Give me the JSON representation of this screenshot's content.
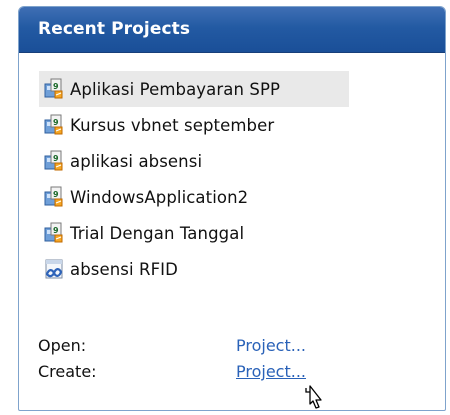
{
  "panel": {
    "title": "Recent Projects"
  },
  "projects": [
    {
      "label": "Aplikasi Pembayaran SPP",
      "icon": "vb-project-icon",
      "selected": true
    },
    {
      "label": "Kursus vbnet september",
      "icon": "vb-project-icon",
      "selected": false
    },
    {
      "label": "aplikasi absensi",
      "icon": "vb-project-icon",
      "selected": false
    },
    {
      "label": "WindowsApplication2",
      "icon": "vb-project-icon",
      "selected": false
    },
    {
      "label": "Trial Dengan Tanggal",
      "icon": "vb-project-icon",
      "selected": false
    },
    {
      "label": "absensi RFID",
      "icon": "vs-solution-icon",
      "selected": false
    }
  ],
  "actions": {
    "open": {
      "label": "Open:",
      "link": "Project..."
    },
    "create": {
      "label": "Create:",
      "link": "Project..."
    }
  },
  "colors": {
    "header_bg": "#235aa3",
    "link": "#2a62b8",
    "selected_row": "#e9e9e9"
  }
}
